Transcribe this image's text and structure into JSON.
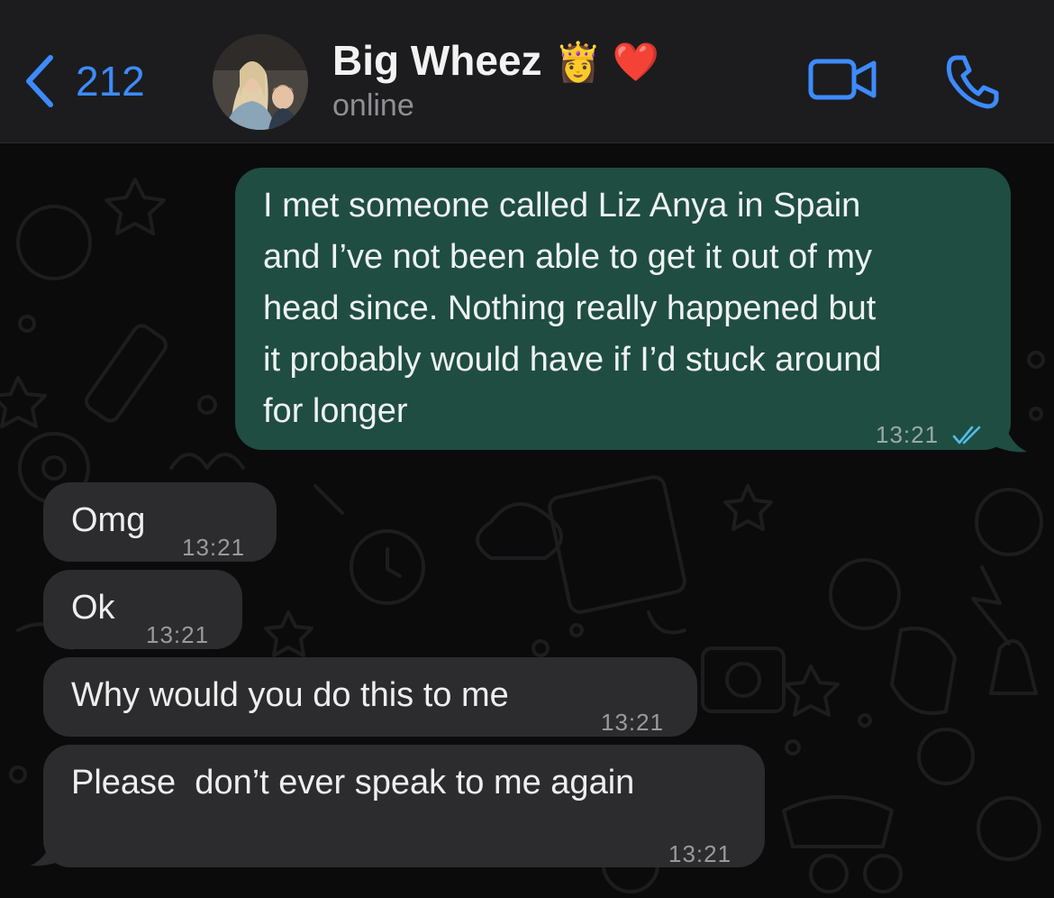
{
  "header": {
    "back_count": "212",
    "contact_name": "Big Wheez",
    "name_emojis": "👸 ❤️",
    "status": "online",
    "video_icon": "video-camera-icon",
    "call_icon": "phone-icon",
    "back_icon": "chevron-left-icon"
  },
  "colors": {
    "accent": "#3d8bfd",
    "outgoing_bubble": "#1f4d42",
    "incoming_bubble": "#2c2c2e",
    "read_ticks": "#53bdeb"
  },
  "messages": [
    {
      "direction": "outgoing",
      "lines": [
        "I met someone called Liz Anya in Spain",
        "and I’ve not been able to get it out of my",
        "head since. Nothing really happened but",
        "it probably would have if I’d stuck around",
        "for longer"
      ],
      "time": "13:21",
      "status": "read"
    },
    {
      "direction": "incoming",
      "text": "Omg",
      "time": "13:21"
    },
    {
      "direction": "incoming",
      "text": "Ok",
      "time": "13:21"
    },
    {
      "direction": "incoming",
      "text": "Why would you do this to me",
      "time": "13:21"
    },
    {
      "direction": "incoming",
      "text": "Please  don’t ever speak to me again",
      "time": "13:21"
    }
  ]
}
